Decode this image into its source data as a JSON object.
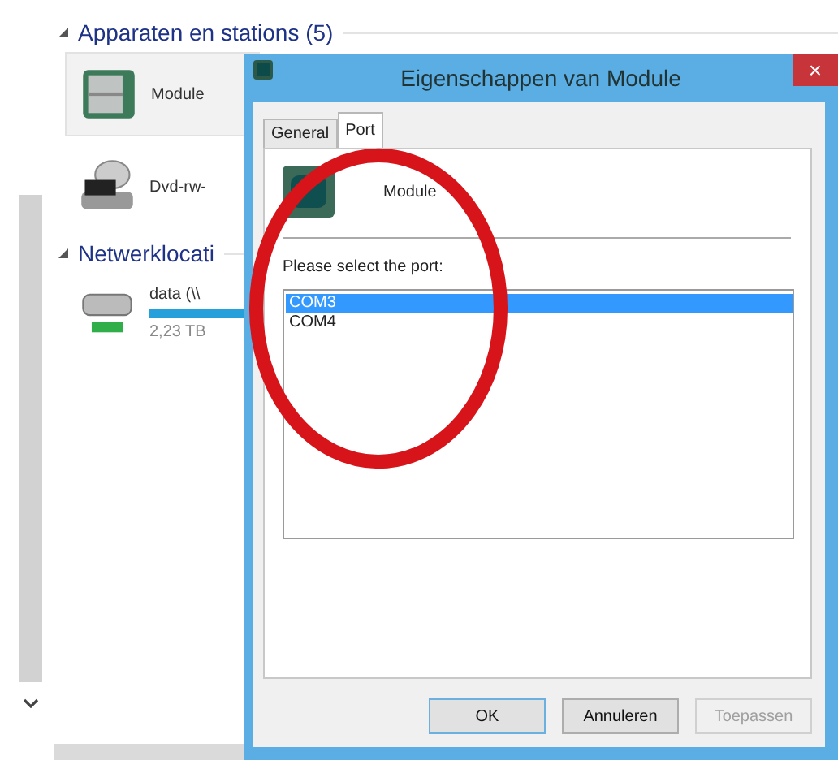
{
  "explorer": {
    "sections": [
      {
        "title": "Apparaten en stations (5)",
        "items": [
          {
            "kind": "module",
            "name": "Module",
            "selected": true
          },
          {
            "kind": "dvd",
            "name": "Dvd-rw-",
            "selected": false
          }
        ]
      },
      {
        "title": "Netwerklocati",
        "items": [
          {
            "kind": "network",
            "name": "data (\\\\",
            "detail": "2,23 TB",
            "selected": false
          }
        ]
      }
    ]
  },
  "dialog": {
    "title": "Eigenschappen van Module",
    "close": "×",
    "tabs": [
      {
        "label": "General",
        "selected": false
      },
      {
        "label": "Port",
        "selected": true
      }
    ],
    "device_name": "Module",
    "prompt": "Please select the port:",
    "ports": [
      {
        "label": "COM3",
        "selected": true
      },
      {
        "label": "COM4",
        "selected": false
      }
    ],
    "buttons": [
      {
        "label": "OK",
        "disabled": false,
        "default": true
      },
      {
        "label": "Annuleren",
        "disabled": false,
        "default": false
      },
      {
        "label": "Toepassen",
        "disabled": true,
        "default": false
      }
    ]
  }
}
